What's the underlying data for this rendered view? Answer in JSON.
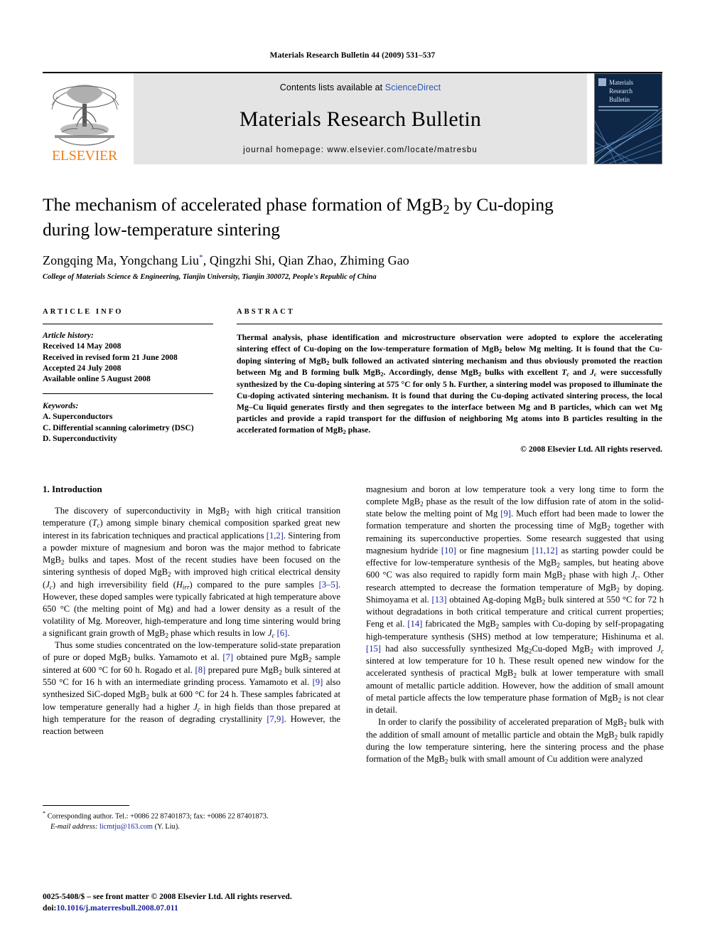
{
  "running_head": "Materials Research Bulletin 44 (2009) 531–537",
  "masthead": {
    "publisher_name": "ELSEVIER",
    "contents_prefix": "Contents lists available at ",
    "contents_link": "ScienceDirect",
    "journal_title": "Materials Research Bulletin",
    "homepage_line": "journal homepage: www.elsevier.com/locate/matresbu",
    "cover_lines": [
      "Materials",
      "Research",
      "Bulletin"
    ]
  },
  "article": {
    "title_line1": "The mechanism of accelerated phase formation of MgB",
    "title_sub1": "2",
    "title_line1b": " by Cu-doping",
    "title_line2": "during low-temperature sintering",
    "authors_pre": "Zongqing Ma, Yongchang Liu",
    "authors_star": "*",
    "authors_post": ", Qingzhi Shi, Qian Zhao, Zhiming Gao",
    "affiliation": "College of Materials Science & Engineering, Tianjin University, Tianjin 300072, People's Republic of China"
  },
  "info": {
    "heading": "ARTICLE INFO",
    "history_label": "Article history:",
    "history": [
      "Received 14 May 2008",
      "Received in revised form 21 June 2008",
      "Accepted 24 July 2008",
      "Available online 5 August 2008"
    ],
    "keywords_label": "Keywords:",
    "keywords": [
      "A. Superconductors",
      "C. Differential scanning calorimetry (DSC)",
      "D. Superconductivity"
    ]
  },
  "abstract": {
    "heading": "ABSTRACT",
    "text": "Thermal analysis, phase identification and microstructure observation were adopted to explore the accelerating sintering effect of Cu-doping on the low-temperature formation of MgB2 below Mg melting. It is found that the Cu-doping sintering of MgB2 bulk followed an activated sintering mechanism and thus obviously promoted the reaction between Mg and B forming bulk MgB2. Accordingly, dense MgB2 bulks with excellent Tc and Jc were successfully synthesized by the Cu-doping sintering at 575 °C for only 5 h. Further, a sintering model was proposed to illuminate the Cu-doping activated sintering mechanism. It is found that during the Cu-doping activated sintering process, the local Mg–Cu liquid generates firstly and then segregates to the interface between Mg and B particles, which can wet Mg particles and provide a rapid transport for the diffusion of neighboring Mg atoms into B particles resulting in the accelerated formation of MgB2 phase.",
    "copyright": "© 2008 Elsevier Ltd. All rights reserved."
  },
  "introduction": {
    "section_title": "1. Introduction",
    "para1": "The discovery of superconductivity in MgB2 with high critical transition temperature (Tc) among simple binary chemical composition sparked great new interest in its fabrication techniques and practical applications [1,2]. Sintering from a powder mixture of magnesium and boron was the major method to fabricate MgB2 bulks and tapes. Most of the recent studies have been focused on the sintering synthesis of doped MgB2 with improved high critical electrical density (Jc) and high irreversibility field (Hirr) compared to the pure samples [3–5]. However, these doped samples were typically fabricated at high temperature above 650 °C (the melting point of Mg) and had a lower density as a result of the volatility of Mg. Moreover, high-temperature and long time sintering would bring a significant grain growth of MgB2 phase which results in low Jc [6].",
    "para2": "Thus some studies concentrated on the low-temperature solid-state preparation of pure or doped MgB2 bulks. Yamamoto et al. [7] obtained pure MgB2 sample sintered at 600 °C for 60 h. Rogado et al. [8] prepared pure MgB2 bulk sintered at 550 °C for 16 h with an intermediate grinding process. Yamamoto et al. [9] also synthesized SiC-doped MgB2 bulk at 600 °C for 24 h. These samples fabricated at low temperature generally had a higher Jc in high fields than those prepared at high temperature for the reason of degrading crystallinity [7,9]. However, the reaction between",
    "para3": "magnesium and boron at low temperature took a very long time to form the complete MgB2 phase as the result of the low diffusion rate of atom in the solid-state below the melting point of Mg [9]. Much effort had been made to lower the formation temperature and shorten the processing time of MgB2 together with remaining its superconductive properties. Some research suggested that using magnesium hydride [10] or fine magnesium [11,12] as starting powder could be effective for low-temperature synthesis of the MgB2 samples, but heating above 600 °C was also required to rapidly form main MgB2 phase with high Jc. Other research attempted to decrease the formation temperature of MgB2 by doping. Shimoyama et al. [13] obtained Ag-doping MgB2 bulk sintered at 550 °C for 72 h without degradations in both critical temperature and critical current properties; Feng et al. [14] fabricated the MgB2 samples with Cu-doping by self-propagating high-temperature synthesis (SHS) method at low temperature; Hishinuma et al. [15] had also successfully synthesized Mg2Cu-doped MgB2 with improved Jc sintered at low temperature for 10 h. These result opened new window for the accelerated synthesis of practical MgB2 bulk at lower temperature with small amount of metallic particle addition. However, how the addition of small amount of metal particle affects the low temperature phase formation of MgB2 is not clear in detail.",
    "para4": "In order to clarify the possibility of accelerated preparation of MgB2 bulk with the addition of small amount of metallic particle and obtain the MgB2 bulk rapidly during the low temperature sintering, here the sintering process and the phase formation of the MgB2 bulk with small amount of Cu addition were analyzed"
  },
  "footnote": {
    "marker": "*",
    "corresponding": "Corresponding author. Tel.: +0086 22 87401873; fax: +0086 22 87401873.",
    "email_label": "E-mail address:",
    "email": "licmtju@163.com",
    "email_suffix": "(Y. Liu)."
  },
  "issn": {
    "line1": "0025-5408/$ – see front matter © 2008 Elsevier Ltd. All rights reserved.",
    "doi_label": "doi:",
    "doi": "10.1016/j.materresbull.2008.07.011"
  },
  "colors": {
    "link_blue": "#18239c",
    "sciencedirect_blue": "#2b56b0",
    "elsevier_orange": "#F07F1A",
    "band_gray": "#e4e4e4"
  }
}
